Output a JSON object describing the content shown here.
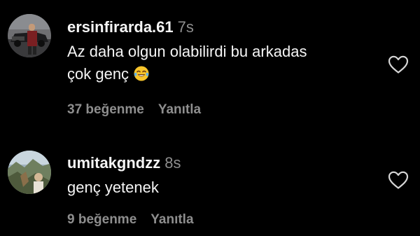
{
  "colors": {
    "background": "#000000",
    "primary_text": "#f5f5f5",
    "secondary_text": "#8e8e8e"
  },
  "comments": [
    {
      "username": "ersinfirarda.61",
      "time": "7s",
      "text_lines": [
        "Az daha olgun olabilirdi bu arkadas",
        "çok genç"
      ],
      "emoji": "face-with-tears-of-joy",
      "likes": "37 beğenme",
      "reply": "Yanıtla",
      "like_icon": "heart-outline-icon"
    },
    {
      "username": "umitakgndzz",
      "time": "8s",
      "text_lines": [
        "genç yetenek"
      ],
      "likes": "9 beğenme",
      "reply": "Yanıtla",
      "like_icon": "heart-outline-icon"
    }
  ]
}
